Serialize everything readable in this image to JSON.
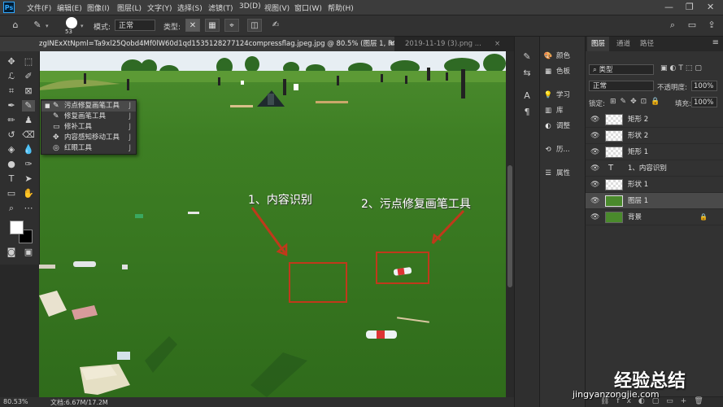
{
  "app": {
    "logo": "Ps"
  },
  "menubar": {
    "items": [
      "文件(F)",
      "编辑(E)",
      "图像(I)",
      "图层(L)",
      "文字(Y)",
      "选择(S)",
      "滤镜(T)",
      "3D(D)",
      "视图(V)",
      "窗口(W)",
      "帮助(H)"
    ],
    "window_controls": [
      "—",
      "❐",
      "✕"
    ]
  },
  "optionsbar": {
    "brush_size": "53",
    "mode_label": "模式:",
    "mode_value": "正常",
    "type_label": "类型:",
    "icons": [
      "home-icon",
      "spot-healing-icon",
      "brush-preset-icon",
      "content-aware-icon",
      "create-texture-icon",
      "proximity-match-icon",
      "sample-all-layers-icon",
      "pressure-icon"
    ],
    "right_icons": [
      "search-icon",
      "workspace-icon",
      "share-icon"
    ]
  },
  "tabs": [
    {
      "label": "zgINExXtNpml=Ta9xl25Qobd4Mf0lW60d1qd1535128277124compressflag.jpeg.jpg @ 80.5% (图层 1, RGB/8#) *",
      "close": "×",
      "active": true
    },
    {
      "label": "2019-11-19 (3).png ...",
      "close": "×",
      "active": false
    }
  ],
  "flyout": {
    "items": [
      {
        "icon": "✎",
        "label": "污点修复画笔工具",
        "key": "J",
        "selected": true
      },
      {
        "icon": "✎",
        "label": "修复画笔工具",
        "key": "J",
        "selected": false
      },
      {
        "icon": "▭",
        "label": "修补工具",
        "key": "J",
        "selected": false
      },
      {
        "icon": "✥",
        "label": "内容感知移动工具",
        "key": "J",
        "selected": false
      },
      {
        "icon": "◎",
        "label": "红眼工具",
        "key": "J",
        "selected": false
      }
    ]
  },
  "annotations": {
    "label1": "1、内容识别",
    "label2": "2、污点修复画笔工具",
    "color": "#c0391b"
  },
  "status": {
    "zoom": "80.53%",
    "doc": "文档:6.67M/17.2M"
  },
  "panels_col2": {
    "items": [
      "颜色",
      "色板",
      "学习",
      "库",
      "调整",
      "历...",
      "属性"
    ]
  },
  "layers": {
    "tabs": [
      "图层",
      "通道",
      "路径"
    ],
    "kind_label": "类型",
    "blend_mode": "正常",
    "opacity_label": "不透明度:",
    "opacity_value": "100%",
    "lock_label": "锁定:",
    "fill_label": "填充:",
    "fill_value": "100%",
    "rows": [
      {
        "name": "矩形 2",
        "kind": "shape",
        "selected": false
      },
      {
        "name": "形状 2",
        "kind": "shape",
        "selected": false
      },
      {
        "name": "矩形 1",
        "kind": "shape",
        "selected": false
      },
      {
        "name": "1、内容识别",
        "kind": "text",
        "selected": false
      },
      {
        "name": "形状 1",
        "kind": "shape",
        "selected": false
      },
      {
        "name": "图层 1",
        "kind": "image",
        "selected": true
      },
      {
        "name": "背景",
        "kind": "image",
        "selected": false,
        "locked": true
      }
    ]
  },
  "watermark": {
    "line1": "经验总结",
    "line2": "jingyanzongjie.com"
  },
  "colors": {
    "accent": "#31a8ff",
    "selected_layer": "#4a4a4a",
    "fg": "#ffffff",
    "bg": "#000000"
  }
}
